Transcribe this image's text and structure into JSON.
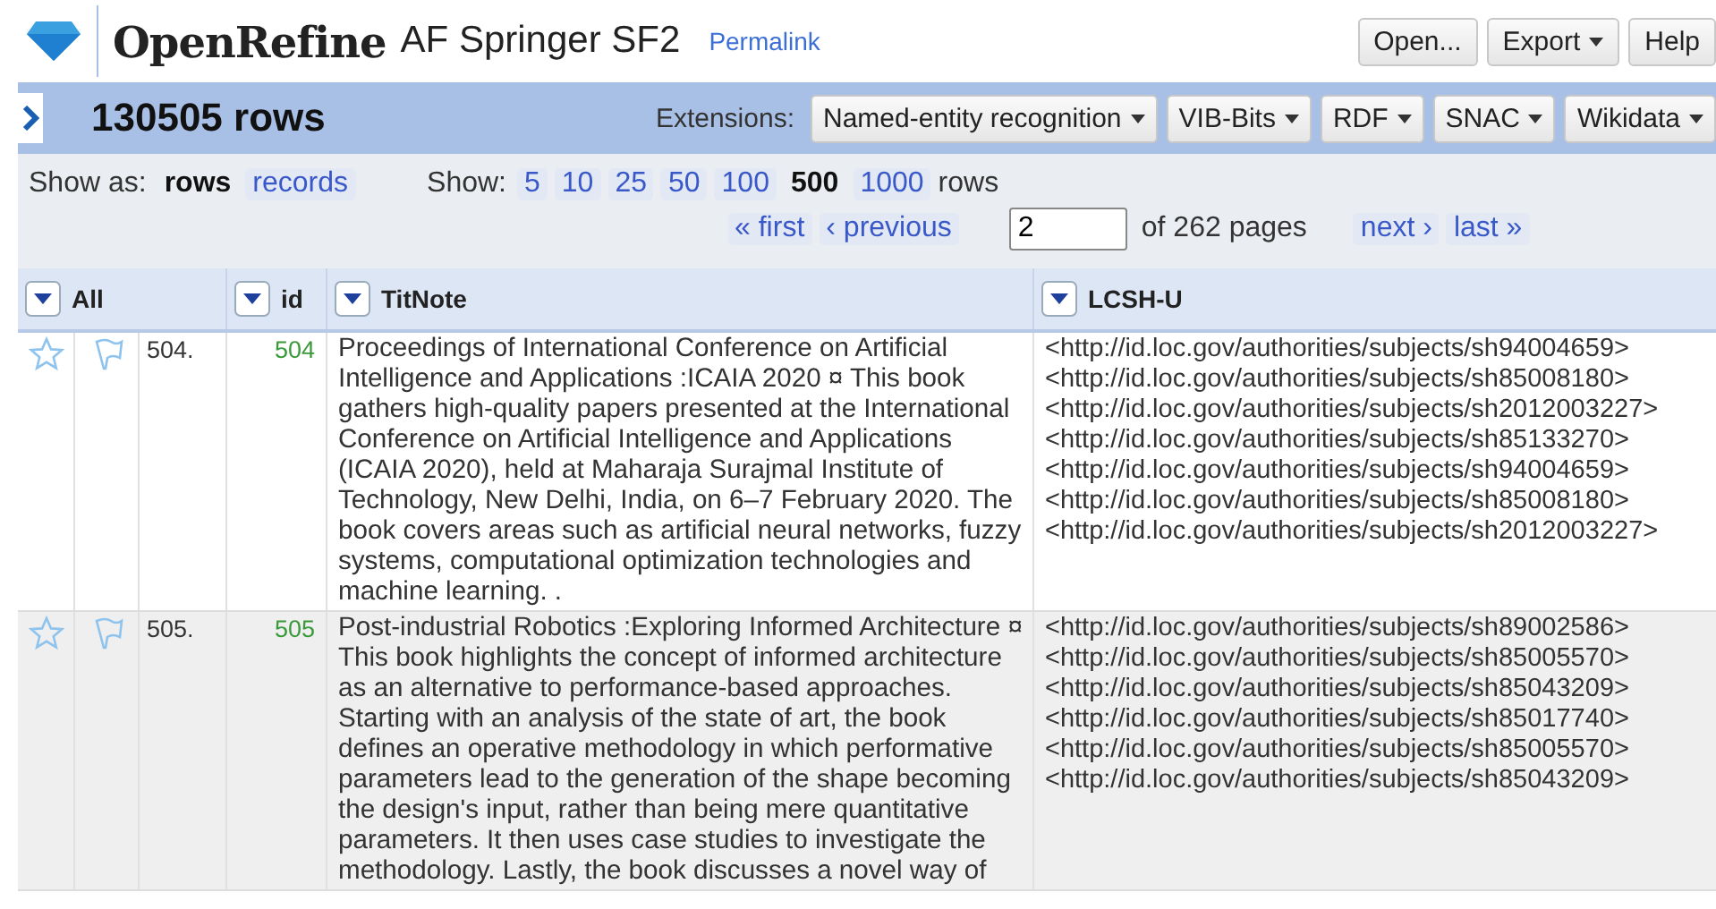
{
  "header": {
    "app_name": "OpenRefine",
    "project_name": "AF Springer SF2",
    "permalink": "Permalink",
    "buttons": [
      {
        "label": "Open...",
        "dropdown": false
      },
      {
        "label": "Export",
        "dropdown": true
      },
      {
        "label": "Help",
        "dropdown": false
      }
    ]
  },
  "summary": {
    "row_count": "130505 rows",
    "extensions_label": "Extensions:",
    "extensions": [
      "Named-entity recognition",
      "VIB-Bits",
      "RDF",
      "SNAC",
      "Wikidata"
    ]
  },
  "view": {
    "show_as_label": "Show as:",
    "modes": [
      {
        "label": "rows",
        "selected": true
      },
      {
        "label": "records",
        "selected": false
      }
    ],
    "show_label": "Show:",
    "sizes": [
      {
        "label": "5",
        "selected": false
      },
      {
        "label": "10",
        "selected": false
      },
      {
        "label": "25",
        "selected": false
      },
      {
        "label": "50",
        "selected": false
      },
      {
        "label": "100",
        "selected": false
      },
      {
        "label": "500",
        "selected": true
      },
      {
        "label": "1000",
        "selected": false
      }
    ],
    "rows_label": "rows",
    "first": "« first",
    "previous": "‹ previous",
    "page": "2",
    "page_suffix": "of 262 pages",
    "next": "next ›",
    "last": "last »"
  },
  "table": {
    "columns": [
      "All",
      "id",
      "TitNote",
      "LCSH-U"
    ],
    "rows": [
      {
        "starred": false,
        "flagged": false,
        "number": "504.",
        "id": "504",
        "titnote": "Proceedings of International Conference on Artificial Intelligence and Applications :ICAIA 2020  ¤ This book gathers high-quality papers presented at the International Conference on Artificial Intelligence and Applications (ICAIA 2020), held at Maharaja Surajmal Institute of Technology, New Delhi, India, on 6–7 February 2020. The book covers areas such as artificial neural networks, fuzzy systems, computational optimization technologies and machine learning. .",
        "lcsh": [
          "<http://id.loc.gov/authorities/subjects/sh94004659>",
          "<http://id.loc.gov/authorities/subjects/sh85008180>",
          "<http://id.loc.gov/authorities/subjects/sh2012003227>",
          "<http://id.loc.gov/authorities/subjects/sh85133270>",
          "<http://id.loc.gov/authorities/subjects/sh94004659>",
          "<http://id.loc.gov/authorities/subjects/sh85008180>",
          "<http://id.loc.gov/authorities/subjects/sh2012003227>"
        ]
      },
      {
        "starred": false,
        "flagged": false,
        "number": "505.",
        "id": "505",
        "titnote": "Post-industrial Robotics :Exploring Informed Architecture  ¤ This book highlights the concept of informed architecture as an alternative to performance-based approaches. Starting with an analysis of the state of art, the book defines an operative methodology in which performative parameters lead to the generation of the shape becoming the design's input, rather than being mere quantitative parameters. It then uses case studies to investigate the methodology. Lastly, the book discusses a novel way of",
        "lcsh": [
          "<http://id.loc.gov/authorities/subjects/sh89002586>",
          "<http://id.loc.gov/authorities/subjects/sh85005570>",
          "<http://id.loc.gov/authorities/subjects/sh85043209>",
          "<http://id.loc.gov/authorities/subjects/sh85017740>",
          "<http://id.loc.gov/authorities/subjects/sh85005570>",
          "<http://id.loc.gov/authorities/subjects/sh85043209>"
        ]
      }
    ]
  }
}
